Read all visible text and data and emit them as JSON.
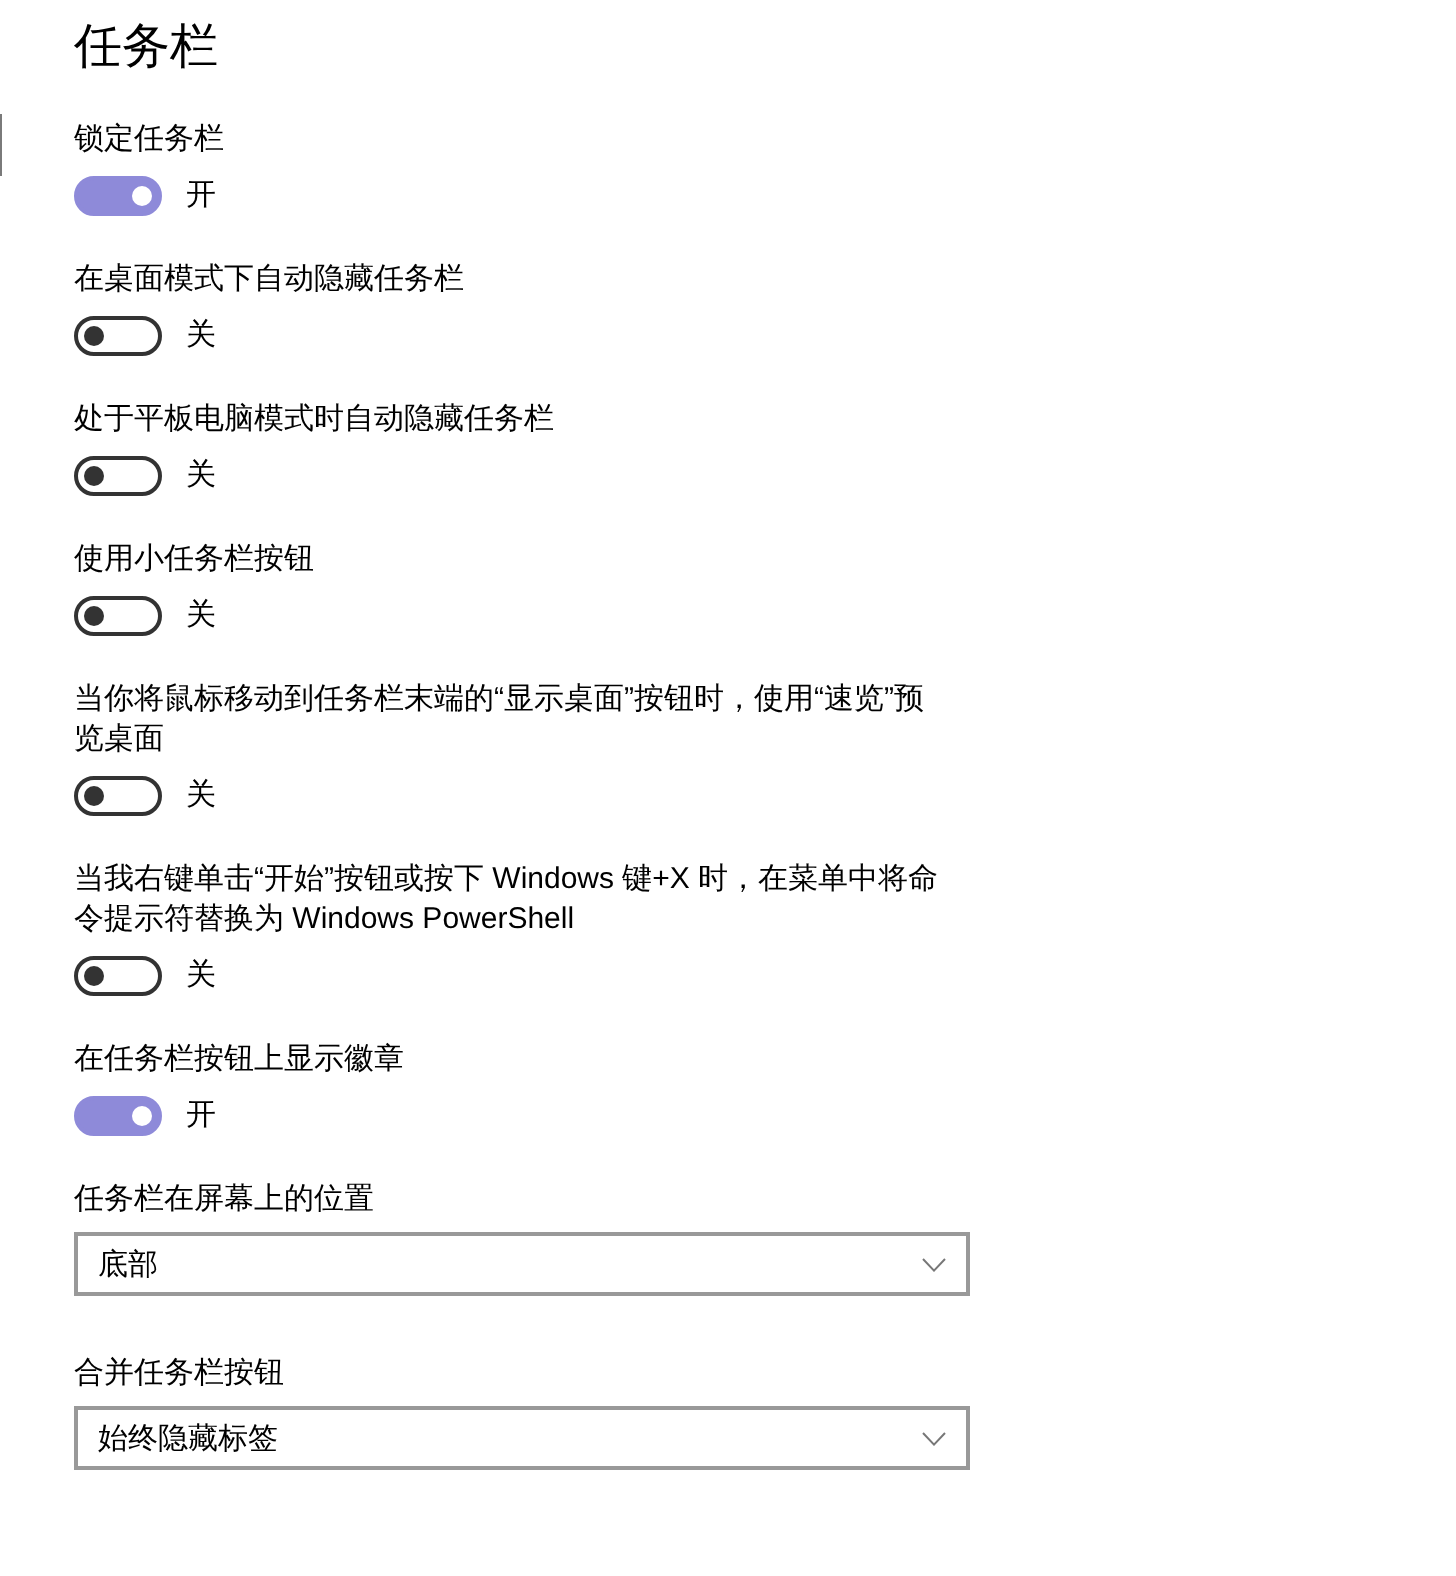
{
  "page": {
    "title": "任务栏"
  },
  "settings": [
    {
      "kind": "toggle",
      "label": "锁定任务栏",
      "on": true,
      "state_text": "开"
    },
    {
      "kind": "toggle",
      "label": "在桌面模式下自动隐藏任务栏",
      "on": false,
      "state_text": "关"
    },
    {
      "kind": "toggle",
      "label": "处于平板电脑模式时自动隐藏任务栏",
      "on": false,
      "state_text": "关"
    },
    {
      "kind": "toggle",
      "label": "使用小任务栏按钮",
      "on": false,
      "state_text": "关"
    },
    {
      "kind": "toggle",
      "label": "当你将鼠标移动到任务栏末端的“显示桌面”按钮时，使用“速览”预览桌面",
      "on": false,
      "state_text": "关"
    },
    {
      "kind": "toggle",
      "label": "当我右键单击“开始”按钮或按下 Windows 键+X 时，在菜单中将命令提示符替换为 Windows PowerShell",
      "on": false,
      "state_text": "关"
    },
    {
      "kind": "toggle",
      "label": "在任务栏按钮上显示徽章",
      "on": true,
      "state_text": "开"
    },
    {
      "kind": "dropdown",
      "label": "任务栏在屏幕上的位置",
      "value": "底部"
    },
    {
      "kind": "dropdown",
      "label": "合并任务栏按钮",
      "value": "始终隐藏标签"
    }
  ]
}
